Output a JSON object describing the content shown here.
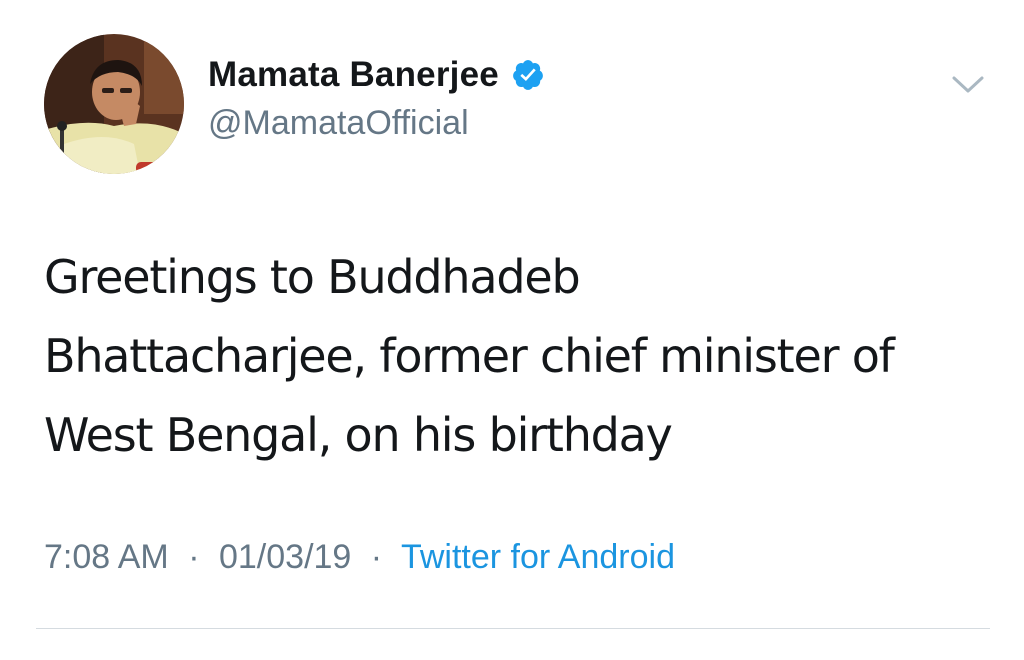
{
  "tweet": {
    "author": {
      "display_name": "Mamata Banerjee",
      "handle": "@MamataOfficial",
      "verified": true,
      "avatar_icon": "profile-photo"
    },
    "text": "Greetings to Buddhadeb\nBhattacharjee, former chief minister of\nWest Bengal, on his birthday",
    "time": "7:08 AM",
    "date": "01/03/19",
    "separator": "·",
    "source": "Twitter for Android",
    "menu_icon": "chevron-down-icon"
  },
  "colors": {
    "text": "#14171a",
    "secondary": "#657786",
    "link": "#1b95e0",
    "verified_badge": "#1da1f2",
    "divider": "#d5dbe0"
  }
}
